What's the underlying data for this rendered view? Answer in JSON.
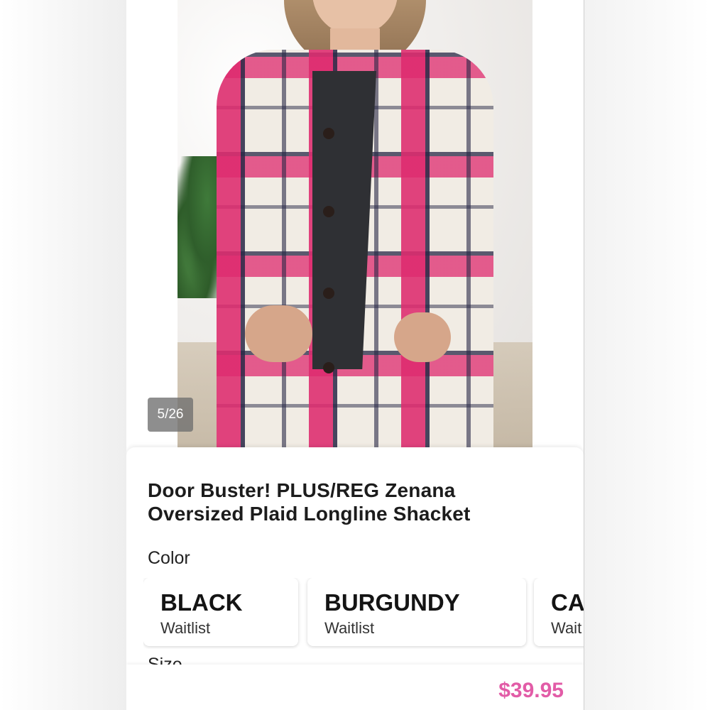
{
  "gallery": {
    "counter": "5/26"
  },
  "product": {
    "title_line1": "Door Buster! PLUS/REG Zenana",
    "title_line2": "Oversized Plaid Longline Shacket",
    "price": "$39.95",
    "price_color": "#e25ca7"
  },
  "color_section": {
    "label": "Color",
    "options": [
      {
        "name": "BLACK",
        "status": "Waitlist"
      },
      {
        "name": "BURGUNDY",
        "status": "Waitlist"
      },
      {
        "name": "CA",
        "status": "Wait"
      }
    ]
  },
  "size_section": {
    "label": "Size"
  }
}
